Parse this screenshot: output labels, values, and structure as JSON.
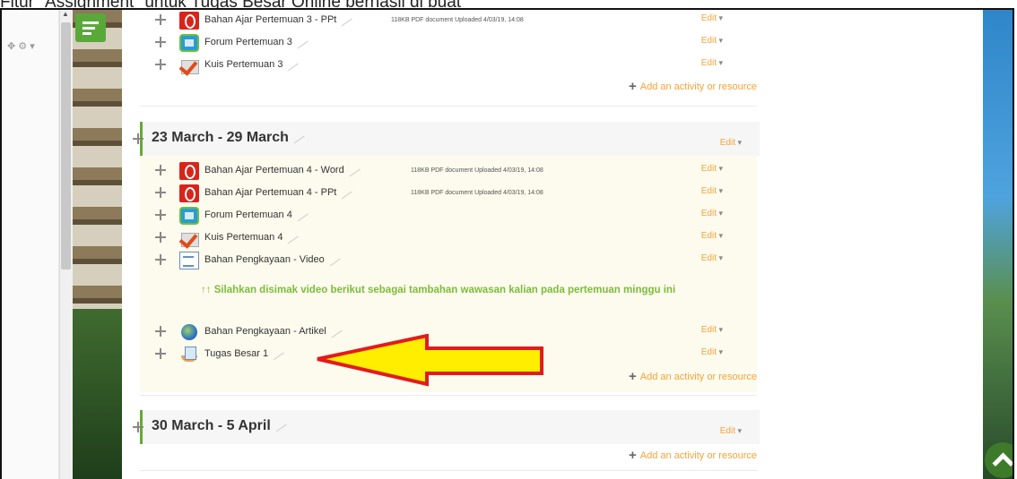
{
  "caption": "Fitur \"Assignment\" untuk Tugas Besar Online berhasil di buat",
  "section_prev": {
    "items": [
      {
        "name": "Bahan Ajar Pertemuan 3 - PPt",
        "meta": "118KB PDF document Uploaded 4/03/19, 14:08",
        "icon": "pdf-icon",
        "edit": "Edit"
      },
      {
        "name": "Forum Pertemuan 3",
        "meta": "",
        "icon": "forum-icon",
        "edit": "Edit"
      },
      {
        "name": "Kuis Pertemuan 3",
        "meta": "",
        "icon": "quiz-icon",
        "edit": "Edit"
      }
    ],
    "add": "Add an activity or resource"
  },
  "section_current": {
    "title": "23 March - 29 March",
    "edit": "Edit",
    "items": [
      {
        "name": "Bahan Ajar Pertemuan 4 - Word",
        "meta": "118KB PDF document Uploaded 4/03/19, 14:08",
        "icon": "pdf-icon",
        "edit": "Edit"
      },
      {
        "name": "Bahan Ajar Pertemuan 4 - PPt",
        "meta": "118KB PDF document Uploaded 4/03/19, 14:08",
        "icon": "pdf-icon",
        "edit": "Edit"
      },
      {
        "name": "Forum Pertemuan 4",
        "meta": "",
        "icon": "forum-icon",
        "edit": "Edit"
      },
      {
        "name": "Kuis Pertemuan 4",
        "meta": "",
        "icon": "quiz-icon",
        "edit": "Edit"
      },
      {
        "name": "Bahan Pengkayaan - Video",
        "meta": "",
        "icon": "video-page-icon",
        "edit": "Edit"
      }
    ],
    "note": "↑↑ Silahkan disimak video berikut sebagai tambahan wawasan kalian pada pertemuan minggu ini",
    "items2": [
      {
        "name": "Bahan Pengkayaan - Artikel",
        "icon": "url-globe-icon",
        "edit": "Edit"
      },
      {
        "name": "Tugas Besar 1",
        "icon": "assignment-icon",
        "edit": "Edit"
      }
    ],
    "add": "Add an activity or resource"
  },
  "section_next": {
    "title": "30 March - 5 April",
    "edit": "Edit",
    "add": "Add an activity or resource"
  },
  "colors": {
    "accent": "#67a83a",
    "link": "#f4a33a",
    "note": "#7cbc3a",
    "arrow_fill": "#ffee00",
    "arrow_stroke": "#e21b1b"
  }
}
